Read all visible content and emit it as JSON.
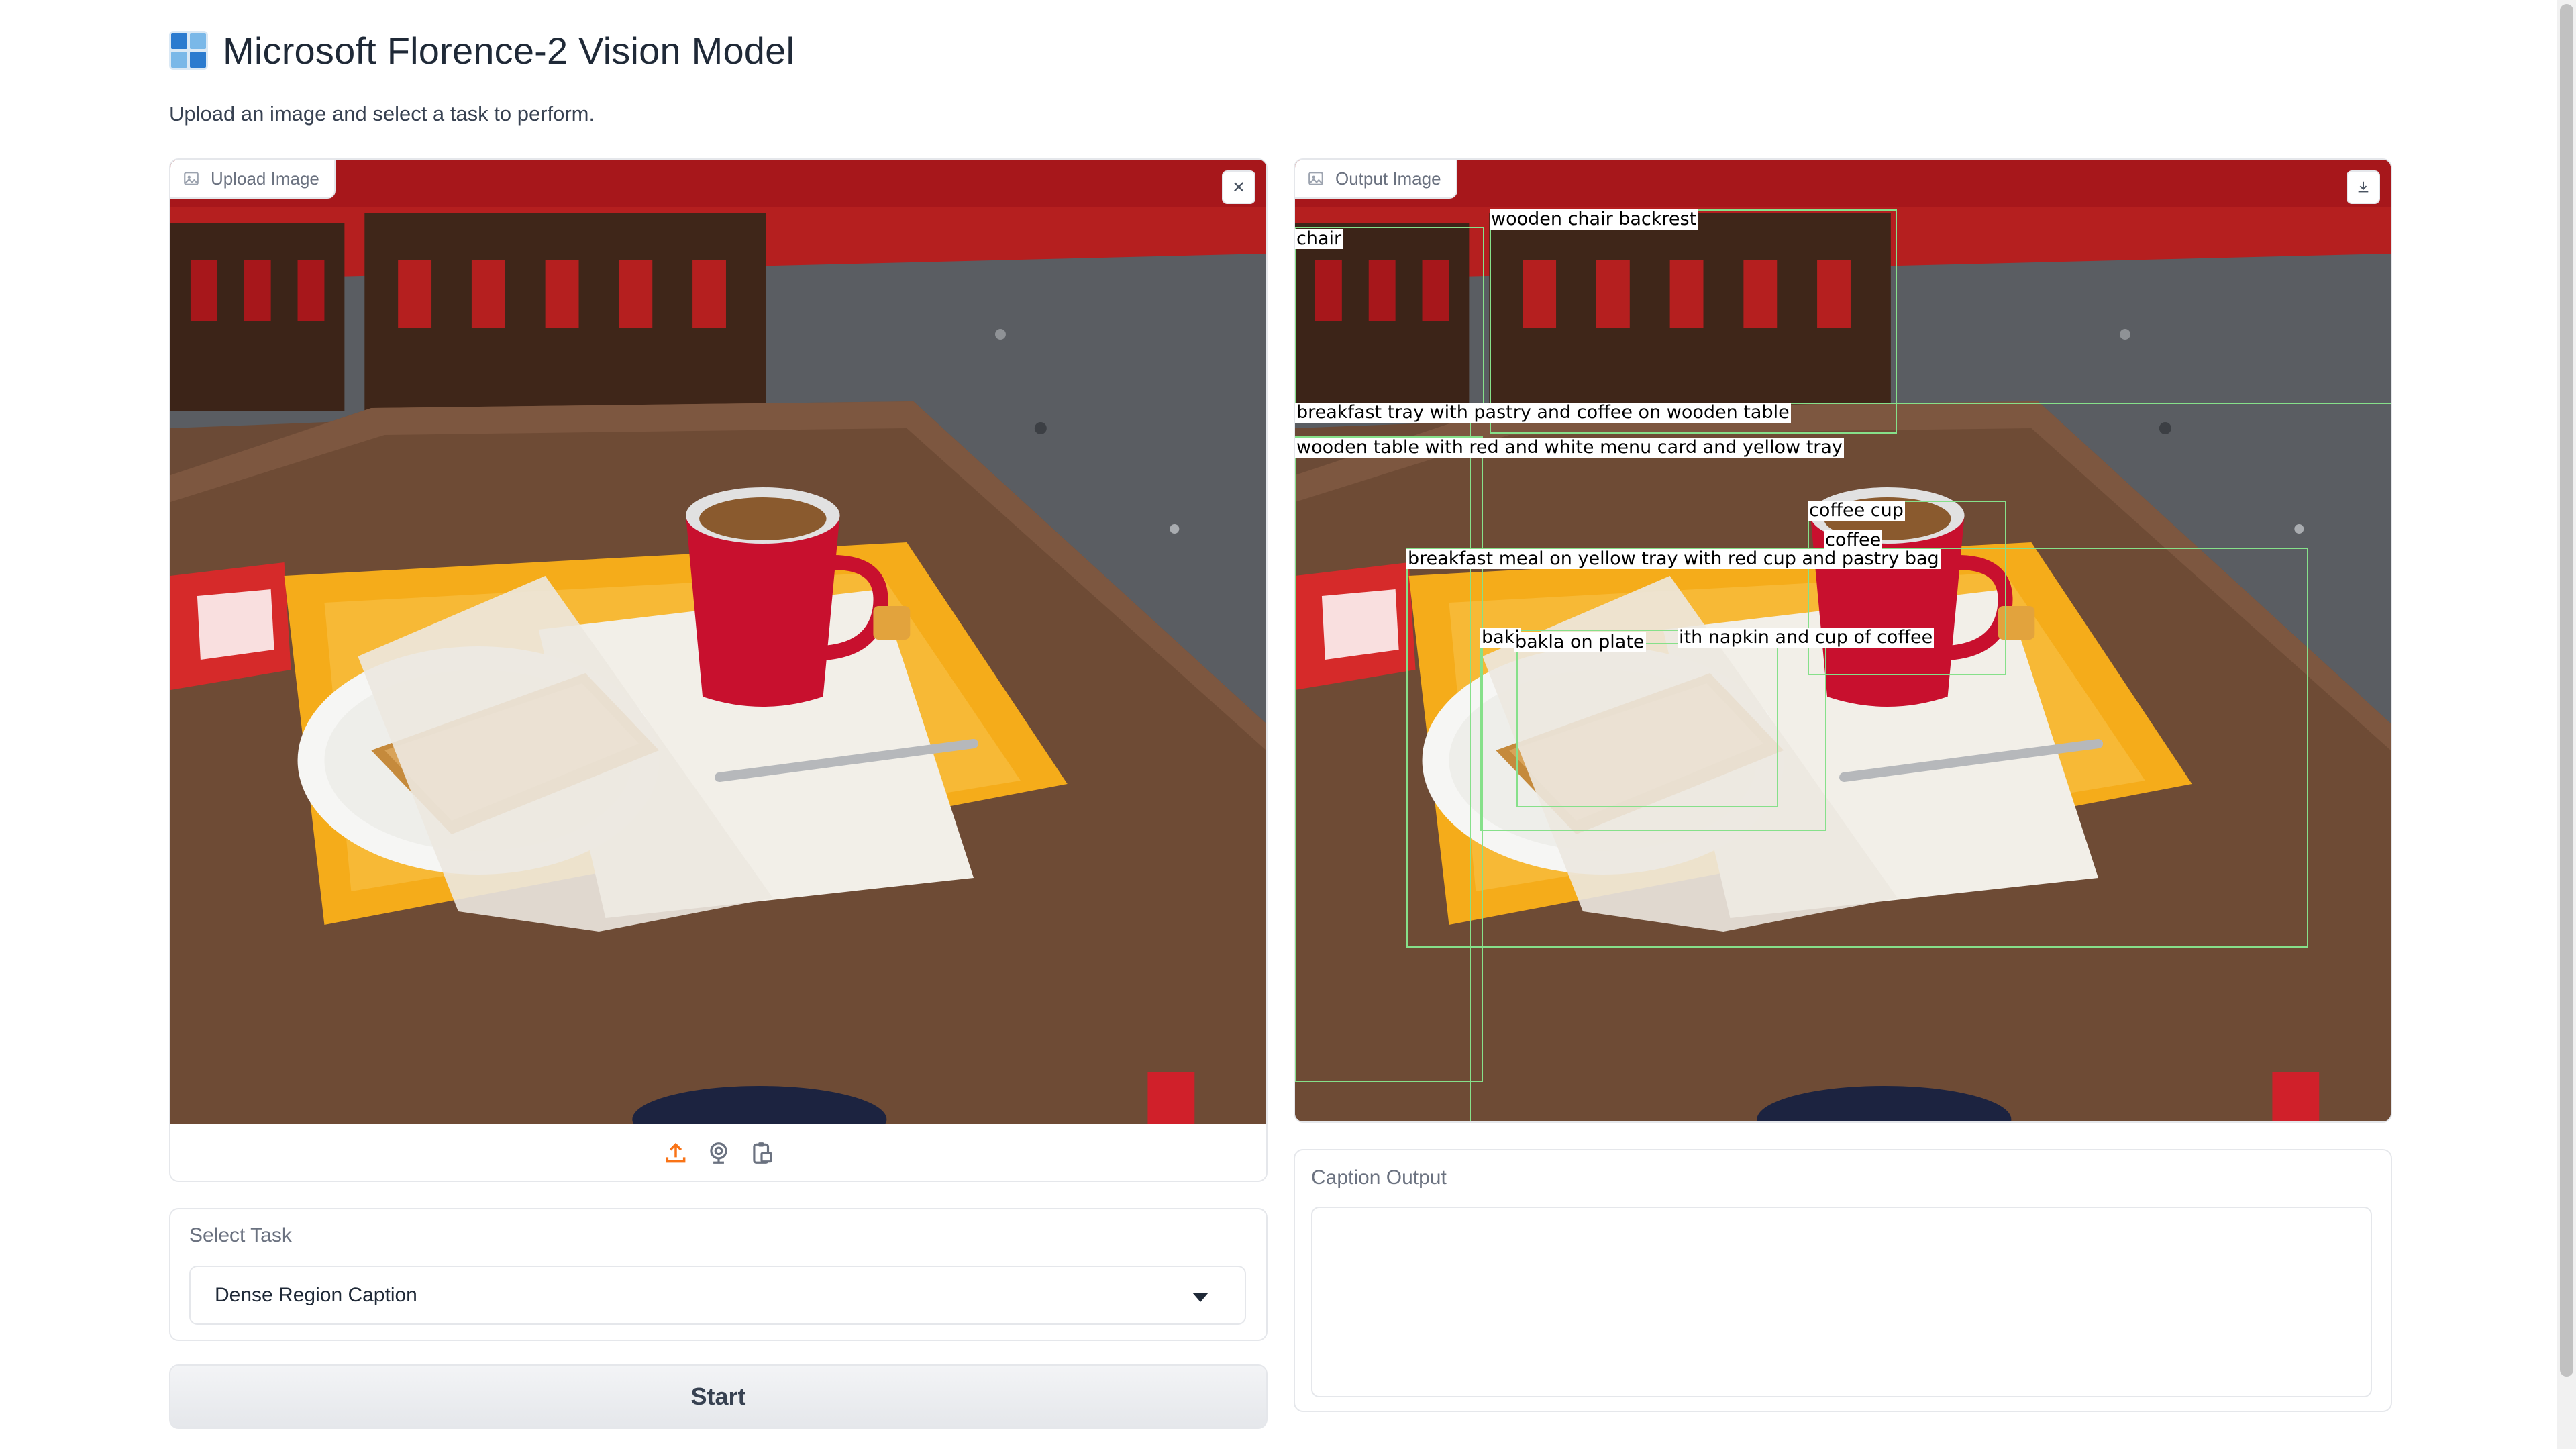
{
  "app": {
    "title": "Microsoft Florence-2 Vision Model",
    "subtitle": "Upload an image and select a task to perform."
  },
  "upload": {
    "label": "Upload Image",
    "label_icon": "image-icon",
    "clear_icon": "close-icon",
    "clear_glyph": "✕",
    "tools": [
      "upload-icon",
      "webcam-icon",
      "clipboard-icon"
    ]
  },
  "output": {
    "label": "Output Image",
    "label_icon": "image-icon",
    "download_icon": "download-icon",
    "detections": [
      {
        "label": "chair"
      },
      {
        "label": "wooden chair backrest"
      },
      {
        "label": "breakfast tray with pastry and coffee on wooden table"
      },
      {
        "label": "wooden table with red and white menu card and yellow tray"
      },
      {
        "label": "coffee cup"
      },
      {
        "label": "coffee"
      },
      {
        "label": "breakfast meal on yellow tray with red cup and pastry bag"
      },
      {
        "label": "bakl"
      },
      {
        "label": "bakla on plate"
      },
      {
        "label": "ith napkin and cup of coffee"
      }
    ]
  },
  "task": {
    "label": "Select Task",
    "selected": "Dense Region Caption"
  },
  "start": {
    "label": "Start"
  },
  "caption": {
    "label": "Caption Output",
    "value": ""
  },
  "colors": {
    "accent": "#f97316",
    "box_outline": "#86e08a",
    "tray": "#f5ac1a",
    "cup": "#c8102e",
    "table": "#6b4a36"
  }
}
